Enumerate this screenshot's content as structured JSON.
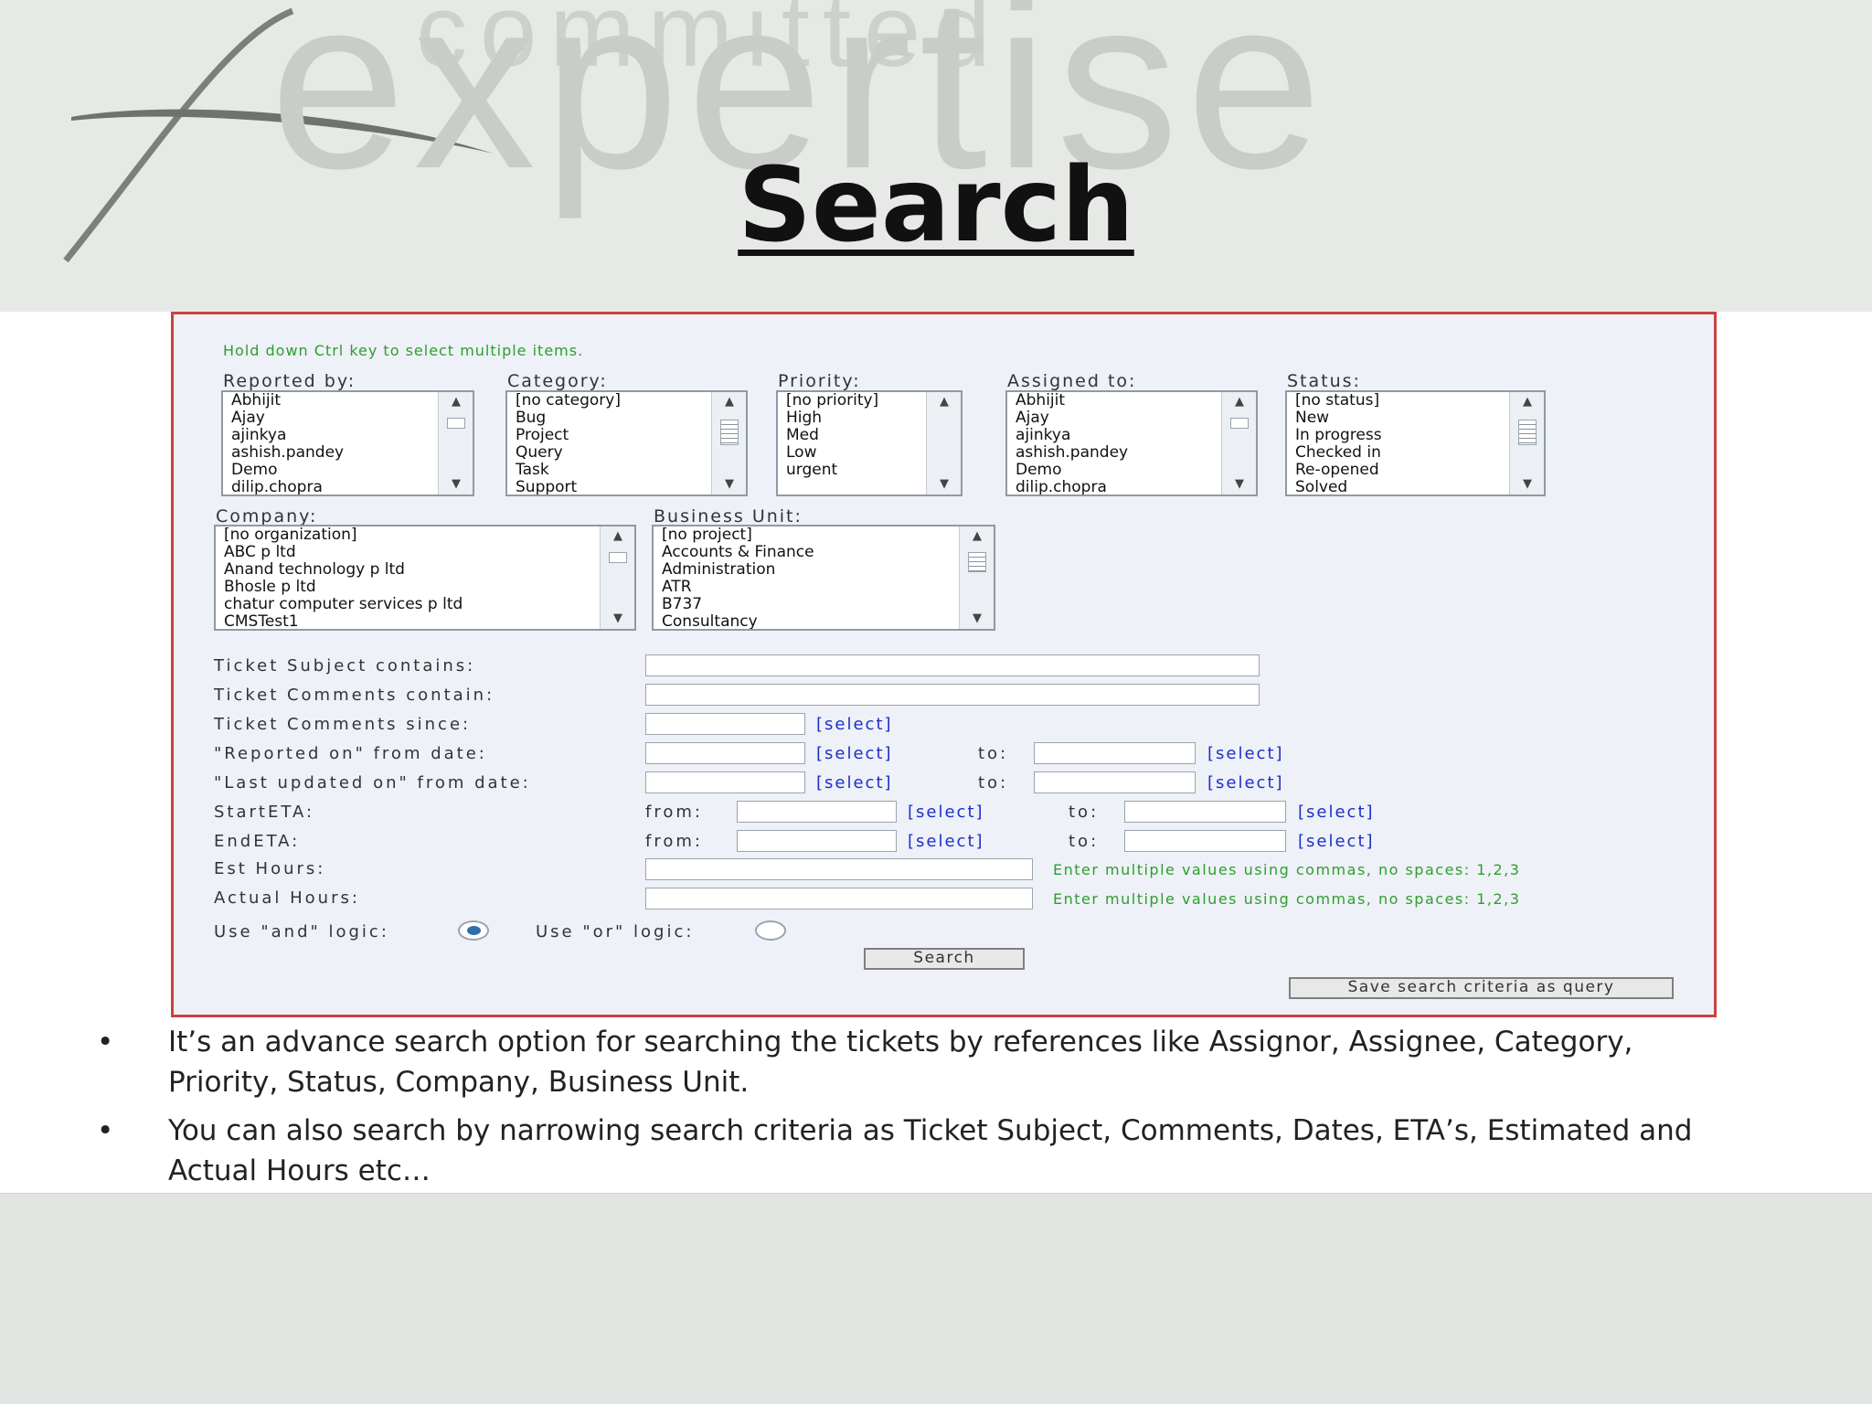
{
  "slide": {
    "logo_top_text": "committed",
    "logo_main_text": "expertise",
    "title": "Search"
  },
  "form": {
    "hint": "Hold down Ctrl key to select multiple items.",
    "reported_by": {
      "label": "Reported by:",
      "options": [
        "Abhijit",
        "Ajay",
        "ajinkya",
        "ashish.pandey",
        "Demo",
        "dilip.chopra"
      ]
    },
    "category": {
      "label": "Category:",
      "options": [
        "[no category]",
        "Bug",
        "Project",
        "Query",
        "Task",
        "Support"
      ]
    },
    "priority": {
      "label": "Priority:",
      "options": [
        "[no priority]",
        "High",
        "Med",
        "Low",
        "urgent"
      ]
    },
    "assigned_to": {
      "label": "Assigned to:",
      "options": [
        "Abhijit",
        "Ajay",
        "ajinkya",
        "ashish.pandey",
        "Demo",
        "dilip.chopra"
      ]
    },
    "status": {
      "label": "Status:",
      "options": [
        "[no status]",
        "New",
        "In progress",
        "Checked in",
        "Re-opened",
        "Solved"
      ]
    },
    "company": {
      "label": "Company:",
      "options": [
        "[no organization]",
        "ABC p ltd",
        "Anand technology p ltd",
        "Bhosle p ltd",
        "chatur computer services p ltd",
        "CMSTest1"
      ]
    },
    "business_unit": {
      "label": "Business Unit:",
      "options": [
        "[no project]",
        "Accounts & Finance",
        "Administration",
        "ATR",
        "B737",
        "Consultancy"
      ]
    },
    "ticket_subject_label": "Ticket Subject contains:",
    "ticket_comments_label": "Ticket Comments contain:",
    "comments_since_label": "Ticket Comments since:",
    "reported_on_label": "\"Reported on\" from date:",
    "last_updated_label": "\"Last updated on\" from date:",
    "start_eta_label": "StartETA:",
    "end_eta_label": "EndETA:",
    "est_hours_label": "Est Hours:",
    "actual_hours_label": "Actual Hours:",
    "select_link": "[select]",
    "from_label": "from:",
    "to_label": "to:",
    "multi_values_note": "Enter multiple values using commas, no spaces: 1,2,3",
    "and_logic_label": "Use \"and\" logic:",
    "or_logic_label": "Use \"or\" logic:",
    "logic_selected": "and",
    "search_button": "Search",
    "save_query_button": "Save search criteria as query"
  },
  "bullets": [
    "It’s an advance search option for searching the tickets by references like Assignor, Assignee, Category, Priority, Status, Company, Business Unit.",
    "You can also search by narrowing search criteria as Ticket Subject, Comments, Dates, ETA’s, Estimated and Actual Hours etc…"
  ],
  "bullet_symbol": "•"
}
